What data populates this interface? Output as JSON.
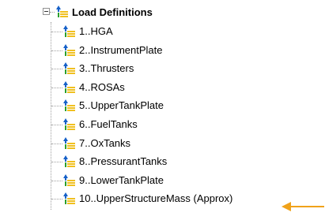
{
  "tree": {
    "root": {
      "label": "Load Definitions",
      "expanded": true,
      "icon": "load-definition-icon"
    },
    "items": [
      {
        "label": "1..HGA"
      },
      {
        "label": "2..InstrumentPlate"
      },
      {
        "label": "3..Thrusters"
      },
      {
        "label": "4..ROSAs"
      },
      {
        "label": "5..UpperTankPlate"
      },
      {
        "label": "6..FuelTanks"
      },
      {
        "label": "7..OxTanks"
      },
      {
        "label": "8..PressurantTanks"
      },
      {
        "label": "9..LowerTankPlate"
      },
      {
        "label": "10..UpperStructureMass (Approx)"
      }
    ],
    "item_icon": "load-definition-icon"
  },
  "annotation": {
    "arrow_icon": "left-arrow-icon",
    "color": "#f0a21a"
  },
  "colors": {
    "icon_blue": "#1560c8",
    "icon_yellow": "#f0c020",
    "icon_green": "#2ca02c"
  }
}
